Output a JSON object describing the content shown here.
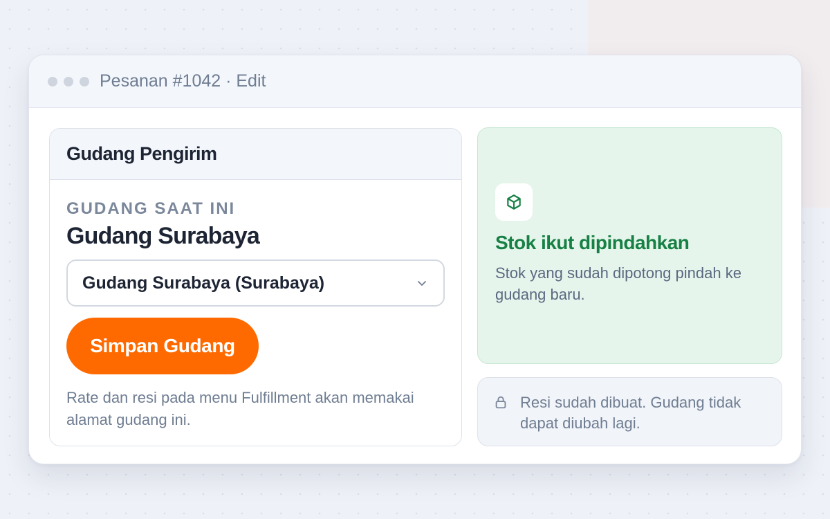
{
  "window": {
    "title": "Pesanan #1042 · Edit"
  },
  "warehouse_card": {
    "header_title": "Gudang Pengirim",
    "current_label": "GUDANG SAAT INI",
    "current_value": "Gudang Surabaya",
    "select_value": "Gudang Surabaya (Surabaya)",
    "save_label": "Simpan Gudang",
    "note": "Rate dan resi pada menu Fulfillment akan memakai alamat gudang ini."
  },
  "stock_card": {
    "icon": "package-icon",
    "title": "Stok ikut dipindahkan",
    "text": "Stok yang sudah dipotong pindah ke gudang baru."
  },
  "lock_card": {
    "icon": "lock-icon",
    "text": "Resi sudah dibuat. Gudang tidak dapat diubah lagi."
  },
  "colors": {
    "accent": "#ff6a00",
    "success": "#178045",
    "success_bg": "#e6f5ec",
    "text_primary": "#1d2433",
    "text_muted": "#6f7d92"
  }
}
